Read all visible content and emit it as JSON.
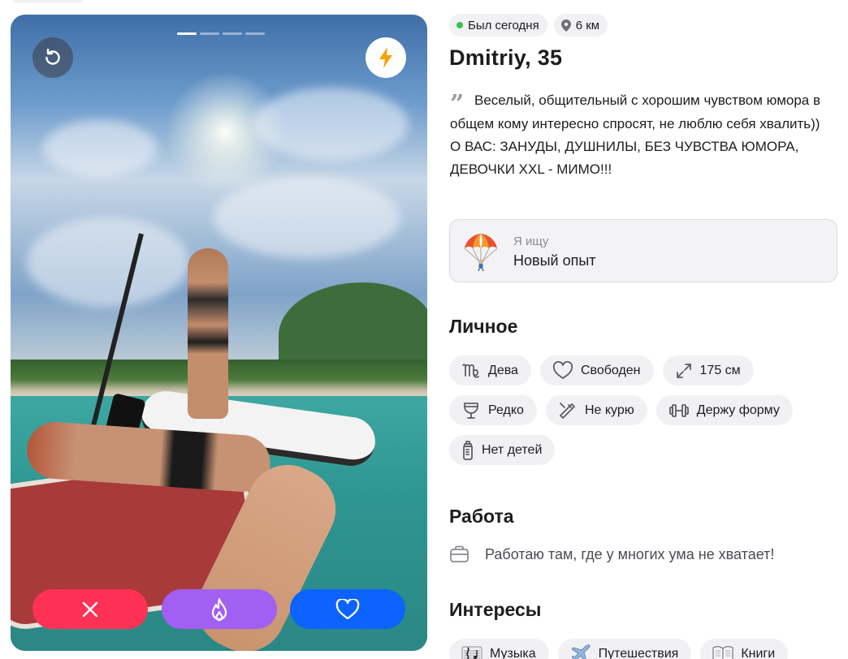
{
  "photo": {
    "total": 4,
    "current_index": 0,
    "buttons": {
      "undo_icon": "undo-icon",
      "boost_icon": "lightning-icon",
      "dislike_icon": "close-icon",
      "superlike_icon": "flame-icon",
      "like_icon": "heart-icon"
    },
    "colors": {
      "dislike": "#ff3154",
      "superlike": "#a160f2",
      "like": "#0c63ff",
      "boost_icon": "#f5a300"
    }
  },
  "profile": {
    "status": "Был сегодня",
    "distance": "6 км",
    "name": "Dmitriy, 35",
    "bio_lines": [
      "Веселый, общительный с хорошим чувством юмора в общем кому интересно спросят, не люблю себя хвалить))",
      "О ВАС: ЗАНУДЫ, ДУШНИЛЫ, БЕЗ ЧУВСТВА ЮМОРА, ДЕВОЧКИ XXL - МИМО!!!"
    ],
    "looking_for": {
      "label": "Я ищу",
      "value": "Новый опыт",
      "icon": "parachute-icon"
    },
    "personal": {
      "title": "Личное",
      "chips": [
        {
          "label": "Дева",
          "icon": "virgo-icon"
        },
        {
          "label": "Свободен",
          "icon": "heart-outline-icon"
        },
        {
          "label": "175 см",
          "icon": "expand-icon"
        },
        {
          "label": "Редко",
          "icon": "wine-glass-icon"
        },
        {
          "label": "Не курю",
          "icon": "cigarette-icon"
        },
        {
          "label": "Держу форму",
          "icon": "dumbbell-icon"
        },
        {
          "label": "Нет детей",
          "icon": "baby-bottle-icon"
        }
      ]
    },
    "work": {
      "title": "Работа",
      "text": "Работаю там, где у многих ума не хватает!",
      "icon": "briefcase-icon"
    },
    "interests": {
      "title": "Интересы",
      "chips": [
        {
          "label": "Музыка",
          "icon": "music-icon"
        },
        {
          "label": "Путешествия",
          "icon": "airplane-icon"
        },
        {
          "label": "Книги",
          "icon": "book-icon"
        }
      ]
    }
  }
}
